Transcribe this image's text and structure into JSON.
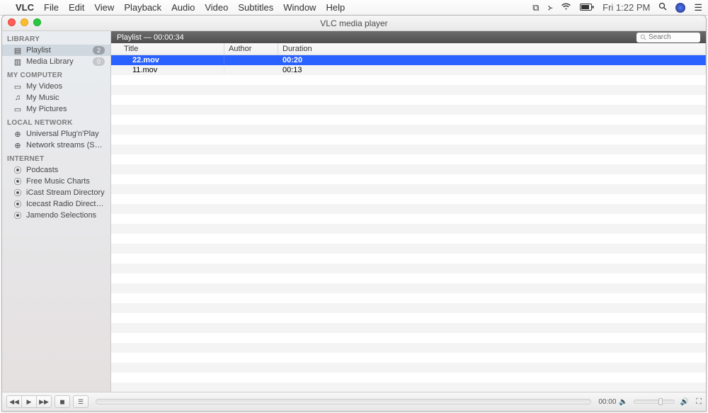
{
  "menubar": {
    "app": "VLC",
    "items": [
      "File",
      "Edit",
      "View",
      "Playback",
      "Audio",
      "Video",
      "Subtitles",
      "Window",
      "Help"
    ],
    "time": "Fri 1:22 PM"
  },
  "window": {
    "title": "VLC media player"
  },
  "sidebar": {
    "sections": [
      {
        "title": "LIBRARY",
        "items": [
          {
            "label": "Playlist",
            "icon": "playlist",
            "badge": "2",
            "selected": true
          },
          {
            "label": "Media Library",
            "icon": "library",
            "badge": "0"
          }
        ]
      },
      {
        "title": "MY COMPUTER",
        "items": [
          {
            "label": "My Videos",
            "icon": "video"
          },
          {
            "label": "My Music",
            "icon": "music"
          },
          {
            "label": "My Pictures",
            "icon": "picture"
          }
        ]
      },
      {
        "title": "LOCAL NETWORK",
        "items": [
          {
            "label": "Universal Plug'n'Play",
            "icon": "net"
          },
          {
            "label": "Network streams (SAP)",
            "icon": "net"
          }
        ]
      },
      {
        "title": "INTERNET",
        "items": [
          {
            "label": "Podcasts",
            "icon": "rss"
          },
          {
            "label": "Free Music Charts",
            "icon": "rss"
          },
          {
            "label": "iCast Stream Directory",
            "icon": "rss"
          },
          {
            "label": "Icecast Radio Directory",
            "icon": "rss"
          },
          {
            "label": "Jamendo Selections",
            "icon": "rss"
          }
        ]
      }
    ]
  },
  "playlist": {
    "header": "Playlist — 00:00:34",
    "search_placeholder": "Search",
    "columns": {
      "title": "Title",
      "author": "Author",
      "duration": "Duration"
    },
    "rows": [
      {
        "title": "22.mov",
        "author": "",
        "duration": "00:20",
        "selected": true
      },
      {
        "title": "11.mov",
        "author": "",
        "duration": "00:13"
      }
    ]
  },
  "controls": {
    "time": "00:00"
  }
}
